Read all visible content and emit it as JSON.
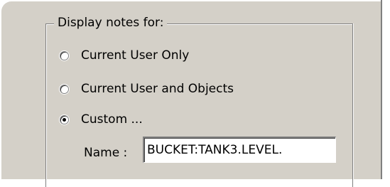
{
  "group": {
    "title": "Display notes for:"
  },
  "options": [
    {
      "label": "Current User Only",
      "checked": false
    },
    {
      "label": "Current User and Objects",
      "checked": false
    },
    {
      "label": "Custom ...",
      "checked": true
    }
  ],
  "name_field": {
    "label": "Name :",
    "value": "BUCKET:TANK3.LEVEL."
  },
  "colors": {
    "face": "#d4d0c8",
    "shadow": "#808080",
    "highlight": "#ffffff"
  }
}
